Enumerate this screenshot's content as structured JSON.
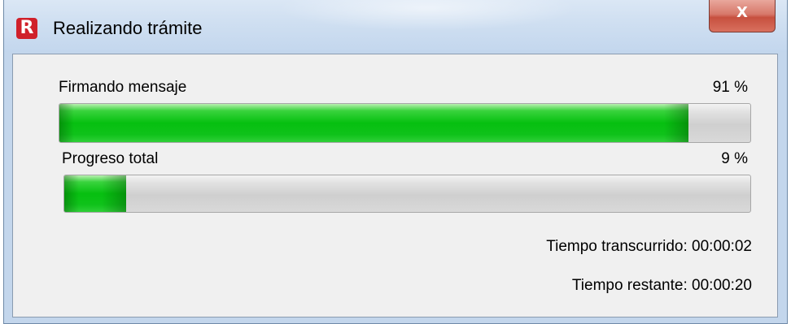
{
  "window": {
    "title": "Realizando trámite",
    "icon": "app-logo-r-icon",
    "icon_letter": "R",
    "close_glyph": "X"
  },
  "tasks": [
    {
      "label": "Firmando mensaje",
      "percent_text": "91 %",
      "progress": 0.91
    },
    {
      "label": "Progreso total",
      "percent_text": "9 %",
      "progress": 0.09
    }
  ],
  "times": {
    "elapsed_label": "Tiempo transcurrido:",
    "elapsed_value": "00:00:02",
    "remaining_label": "Tiempo restante:",
    "remaining_value": "00:00:20"
  },
  "colors": {
    "progress_fill": "#06c010",
    "progress_track": "#d4d4d4",
    "close_button": "#c7503f",
    "app_icon": "#d0202a"
  }
}
